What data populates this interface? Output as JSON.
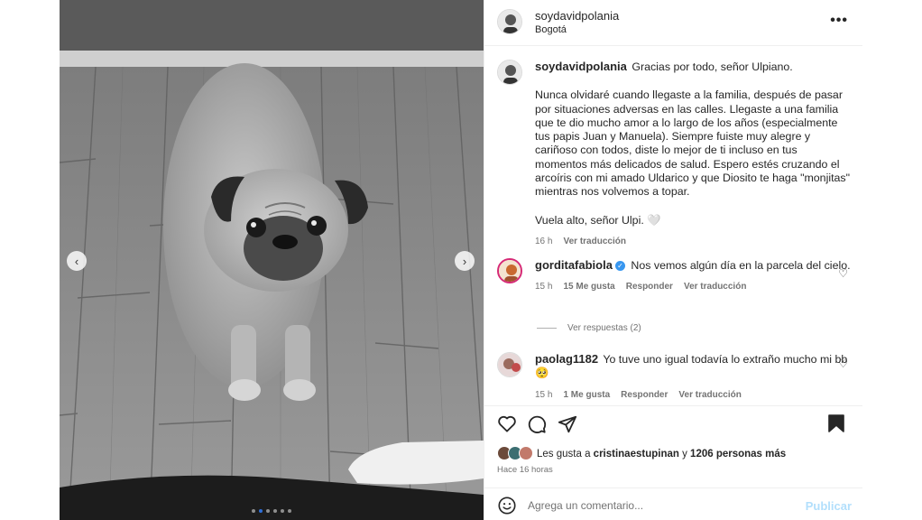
{
  "post": {
    "author": "soydavidpolania",
    "location": "Bogotá",
    "more_icon": "more-options-icon",
    "carousel": {
      "total": 6,
      "active_index": 1
    }
  },
  "caption": {
    "author": "soydavidpolania",
    "first_line": "Gracias por todo, señor Ulpiano.",
    "paragraph": "Nunca olvidaré cuando llegaste a la familia, después de pasar por situaciones adversas en las calles. Llegaste a una familia que te dio mucho amor a lo largo de los años (especialmente tus papis Juan y Manuela). Siempre fuiste muy alegre y cariñoso con todos, diste lo mejor de ti incluso en tus momentos más delicados de salud. Espero estés cruzando el arcoíris con mi amado Uldarico y que Diosito te haga \"monjitas\" mientras nos volvemos a topar.",
    "closing": "Vuela alto, señor Ulpi. 🤍",
    "time": "16 h",
    "see_translation": "Ver traducción"
  },
  "comments": [
    {
      "author": "gorditafabiola",
      "verified": true,
      "text": "Nos vemos algún día en la parcela del cielo.",
      "time": "15 h",
      "likes": "15 Me gusta",
      "reply": "Responder",
      "see_translation": "Ver traducción",
      "view_replies": "Ver respuestas (2)"
    },
    {
      "author": "paolag1182",
      "verified": false,
      "text": "Yo tuve uno igual todavía lo extraño mucho mi bb 🥺",
      "time": "15 h",
      "likes": "1 Me gusta",
      "reply": "Responder",
      "see_translation": "Ver traducción"
    }
  ],
  "likes": {
    "prefix": "Les gusta a",
    "user": "cristinaestupinan",
    "connector": "y",
    "others": "1206 personas más"
  },
  "timestamp": "Hace 16 horas",
  "add_comment": {
    "placeholder": "Agrega un comentario...",
    "post_label": "Publicar"
  },
  "colors": {
    "accent": "#3897f0",
    "post_disabled": "#b2dffc",
    "muted": "#737373",
    "carousel_active": "#2f6fd8"
  }
}
